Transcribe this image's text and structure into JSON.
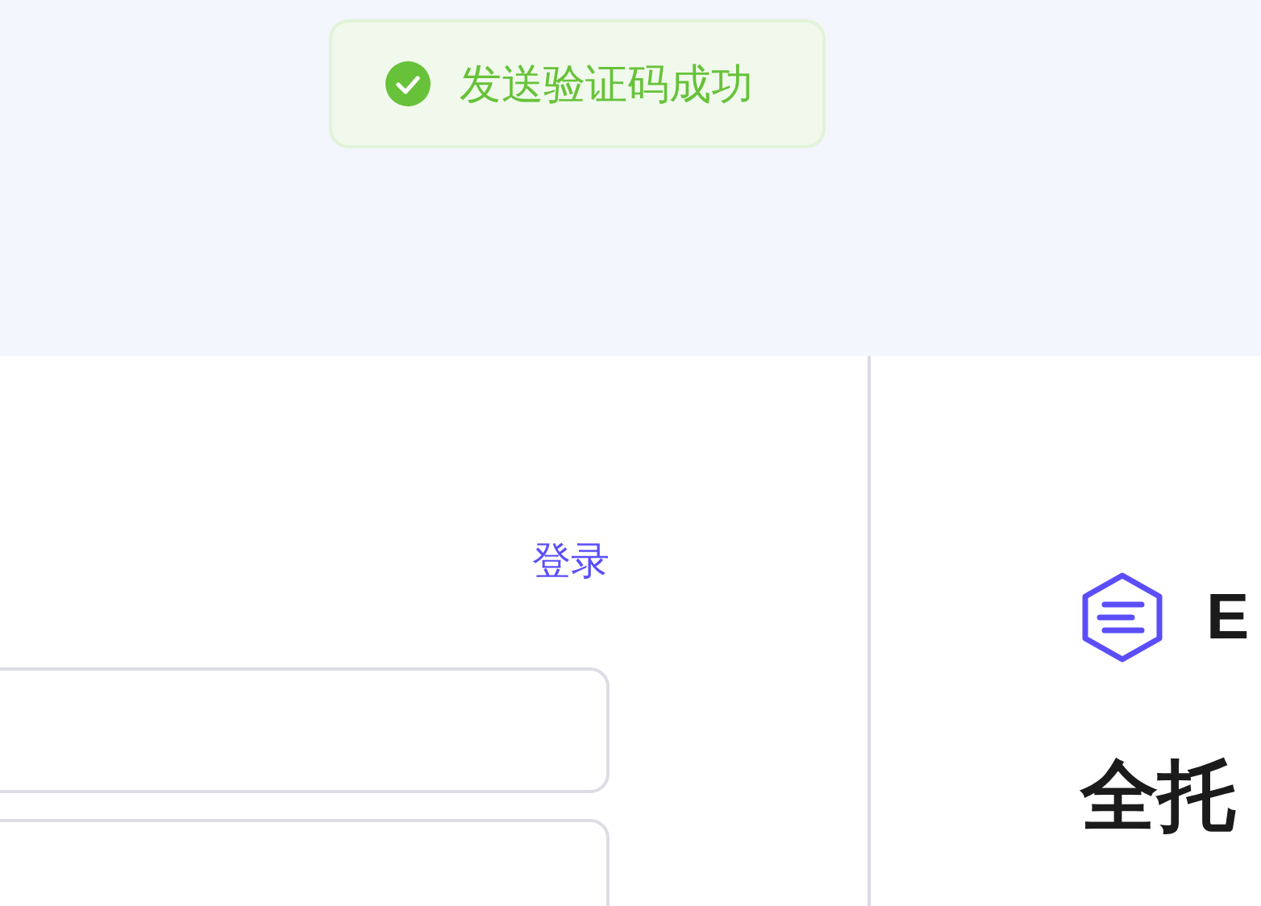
{
  "toast": {
    "kind": "success",
    "message": "发送验证码成功"
  },
  "login_panel": {
    "link": "登录",
    "fields": [
      {
        "kind": "input"
      },
      {
        "kind": "input"
      }
    ]
  },
  "brand_panel": {
    "logo_text": "E",
    "heading": "全托"
  }
}
